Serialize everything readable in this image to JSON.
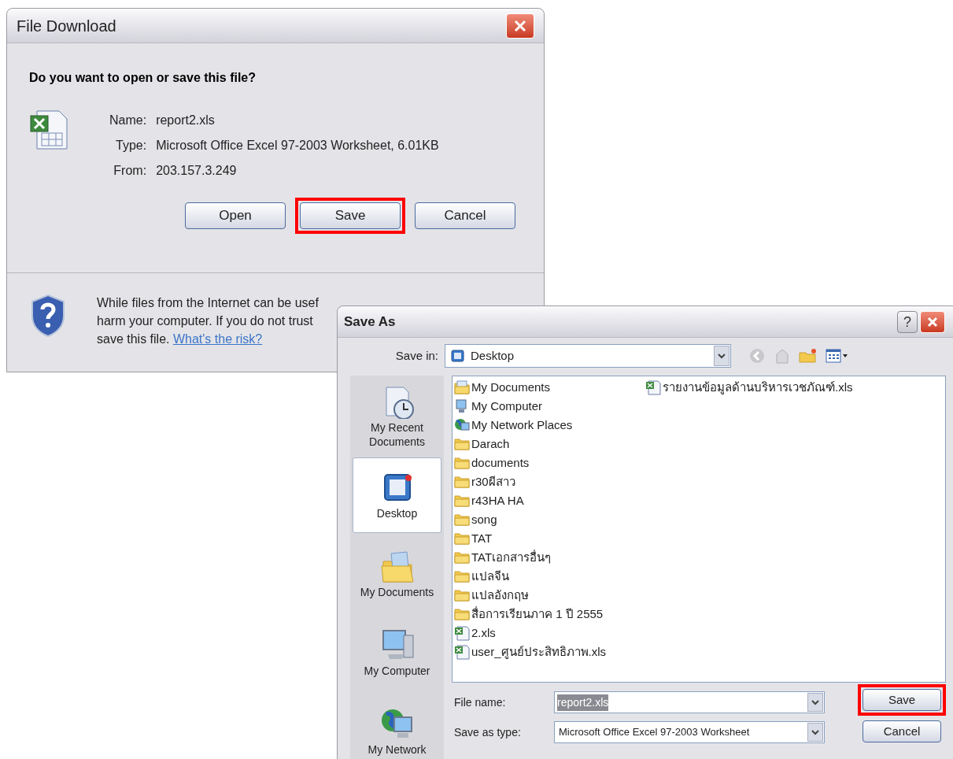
{
  "file_download": {
    "title": "File Download",
    "question": "Do you want to open or save this file?",
    "details": [
      {
        "label": "Name:",
        "value": "report2.xls"
      },
      {
        "label": "Type:",
        "value": "Microsoft Office Excel 97-2003 Worksheet, 6.01KB"
      },
      {
        "label": "From:",
        "value": "203.157.3.249"
      }
    ],
    "buttons": [
      {
        "label": "Open",
        "highlighted": false
      },
      {
        "label": "Save",
        "highlighted": true
      },
      {
        "label": "Cancel",
        "highlighted": false
      }
    ],
    "warning_lines": [
      "While files from the Internet can be usef",
      "harm your computer. If you do not trust",
      "save this file."
    ],
    "risk_link": "What's the risk?"
  },
  "save_as": {
    "title": "Save As",
    "help_glyph": "?",
    "save_in_label": "Save in:",
    "save_in_value": "Desktop",
    "places": [
      {
        "kind": "recent",
        "label": "My Recent Documents",
        "selected": false
      },
      {
        "kind": "desktop",
        "label": "Desktop",
        "selected": true
      },
      {
        "kind": "documents",
        "label": "My Documents",
        "selected": false
      },
      {
        "kind": "computer",
        "label": "My Computer",
        "selected": false
      },
      {
        "kind": "network",
        "label": "My Network",
        "selected": false
      }
    ],
    "files": [
      {
        "kind": "documents",
        "name": "My Documents"
      },
      {
        "kind": "computer",
        "name": "My Computer"
      },
      {
        "kind": "network",
        "name": "My Network Places"
      },
      {
        "kind": "folder",
        "name": "Darach"
      },
      {
        "kind": "folder",
        "name": "documents"
      },
      {
        "kind": "folder",
        "name": "r30ผีสาว"
      },
      {
        "kind": "folder",
        "name": "r43HA HA"
      },
      {
        "kind": "folder",
        "name": "song"
      },
      {
        "kind": "folder",
        "name": "TAT"
      },
      {
        "kind": "folder",
        "name": "TATเอกสารอื่นๆ"
      },
      {
        "kind": "folder",
        "name": "แปลจีน"
      },
      {
        "kind": "folder",
        "name": "แปลอังกฤษ"
      },
      {
        "kind": "folder",
        "name": "สื่อการเรียนภาค 1 ปี 2555"
      },
      {
        "kind": "excel",
        "name": "2.xls"
      },
      {
        "kind": "excel",
        "name": "user_ศูนย์ประสิทธิภาพ.xls"
      },
      {
        "kind": "excel",
        "name": "รายงานข้อมูลด้านบริหารเวชภัณฑ์.xls"
      }
    ],
    "file_name_label": "File name:",
    "file_name_value": "report2.xls",
    "file_name_selected": true,
    "type_label": "Save as type:",
    "type_value": "Microsoft Office Excel 97-2003 Worksheet",
    "buttons": [
      {
        "label": "Save",
        "highlighted": true
      },
      {
        "label": "Cancel",
        "highlighted": false
      }
    ]
  }
}
